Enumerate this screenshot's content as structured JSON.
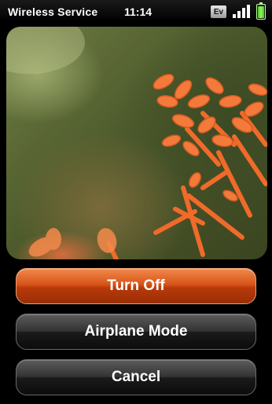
{
  "statusbar": {
    "carrier": "Wireless Service",
    "time": "11:14",
    "network_badge": "Ev",
    "signal_icon": "signal-bars-icon",
    "battery_icon": "battery-icon",
    "battery_color": "#43c91a"
  },
  "dialog": {
    "turn_off_label": "Turn Off",
    "airplane_label": "Airplane Mode",
    "cancel_label": "Cancel"
  },
  "colors": {
    "primary_button": "#d8541a",
    "secondary_button": "#333333"
  }
}
